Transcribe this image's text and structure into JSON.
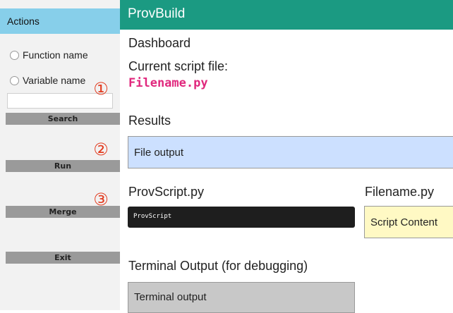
{
  "sidebar": {
    "header": "Actions",
    "radio_options": [
      "Function name",
      "Variable name"
    ],
    "search_value": "",
    "buttons": [
      "Search",
      "Run",
      "Merge",
      "Exit"
    ],
    "annotations": [
      "①",
      "②",
      "③"
    ]
  },
  "app": {
    "title": "ProvBuild"
  },
  "main": {
    "dashboard_label": "Dashboard",
    "current_file_label": "Current script file:",
    "filename": "Filename.py",
    "results_label": "Results",
    "file_output": "File output",
    "provscript_title": "ProvScript.py",
    "provscript_content": "ProvScript",
    "filename_title": "Filename.py",
    "script_content": "Script Content",
    "terminal_title": "Terminal Output (for debugging)",
    "terminal_output": "Terminal output"
  },
  "colors": {
    "topbar": "#1b9a82",
    "sidebar_header": "#87cfea",
    "annotation": "#e23b1f",
    "filename": "#e0287d",
    "file_output_bg": "#cce0ff",
    "script_content_bg": "#fff9c4",
    "terminal_bg": "#c8c8c8"
  }
}
